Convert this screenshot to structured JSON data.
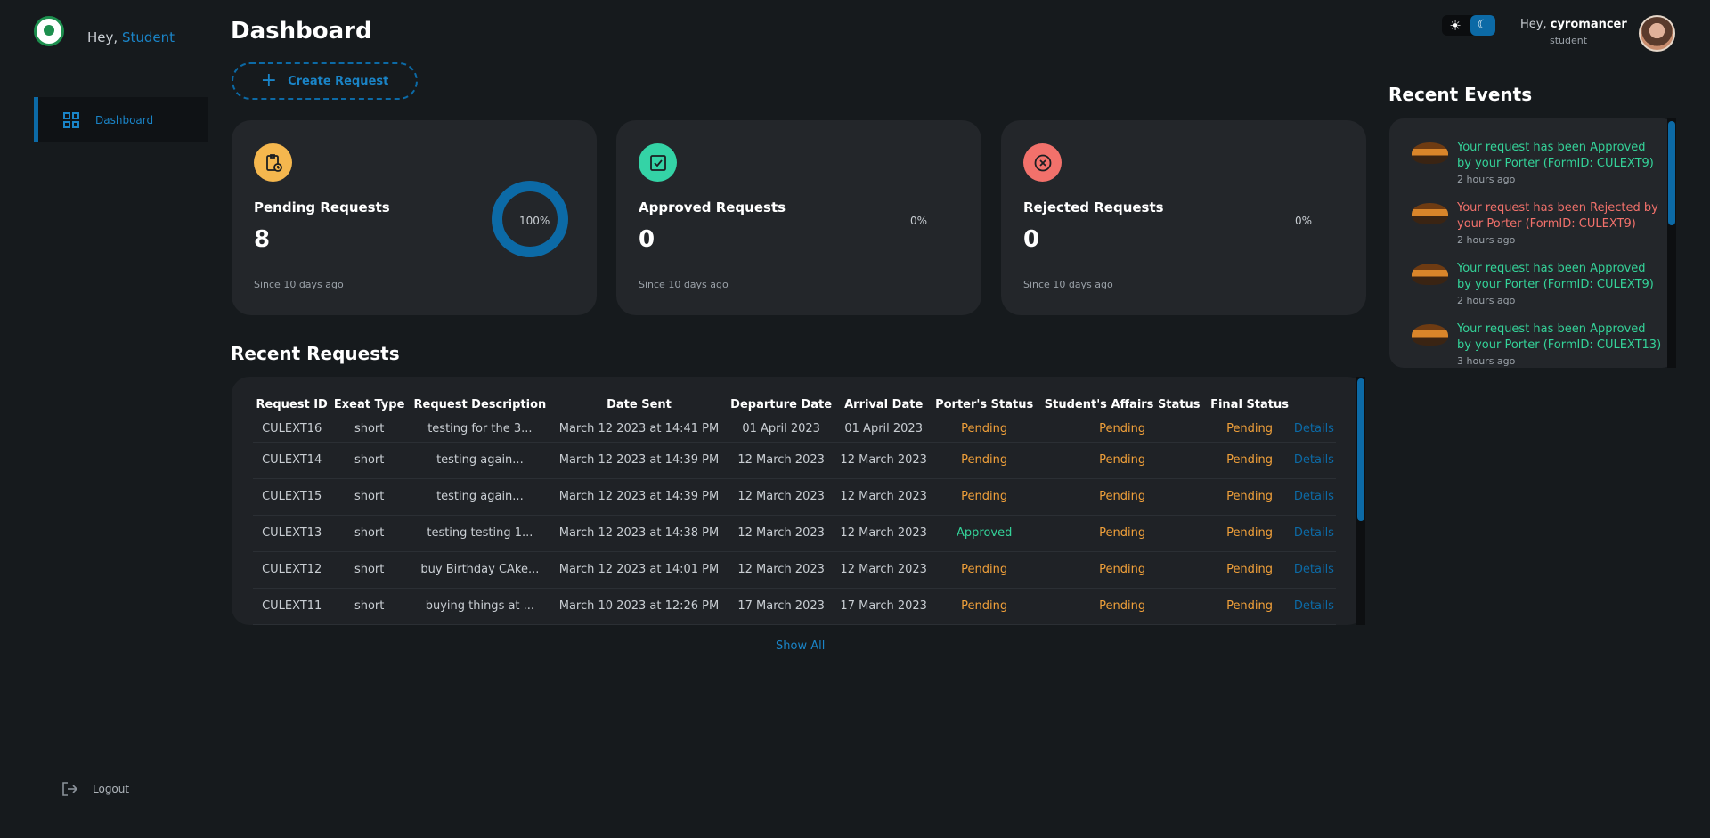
{
  "sidebar": {
    "greeting_prefix": "Hey,",
    "greeting_name": "Student",
    "nav": [
      {
        "label": "Dashboard",
        "icon": "dashboard-icon"
      }
    ],
    "logout_label": "Logout"
  },
  "header": {
    "title": "Dashboard",
    "create_request_label": "Create Request",
    "user_greeting_prefix": "Hey,",
    "user_name": "cyromancer",
    "user_role": "student",
    "theme": "dark"
  },
  "cards": [
    {
      "title": "Pending Requests",
      "count": "8",
      "percent_label": "100%",
      "percent_value": 1.0,
      "since": "Since 10 days ago",
      "icon": "clipboard-clock-icon",
      "icon_bg": "#f5b74e"
    },
    {
      "title": "Approved Requests",
      "count": "0",
      "percent_label": "0%",
      "percent_value": 0,
      "since": "Since 10 days ago",
      "icon": "check-square-icon",
      "icon_bg": "#34d3a6"
    },
    {
      "title": "Rejected Requests",
      "count": "0",
      "percent_label": "0%",
      "percent_value": 0,
      "since": "Since 10 days ago",
      "icon": "x-circle-icon",
      "icon_bg": "#f2716b"
    }
  ],
  "recent_requests": {
    "title": "Recent Requests",
    "columns": [
      "Request ID",
      "Exeat Type",
      "Request Description",
      "Date Sent",
      "Departure Date",
      "Arrival Date",
      "Porter's Status",
      "Student's Affairs Status",
      "Final Status",
      ""
    ],
    "rows": [
      {
        "id": "CULEXT16",
        "type": "short",
        "desc": "testing for the 3...",
        "sent": "March 12 2023 at 14:41 PM",
        "departure": "01 April 2023",
        "arrival": "01 April 2023",
        "porter": "Pending",
        "affairs": "Pending",
        "final": "Pending",
        "action": "Details"
      },
      {
        "id": "CULEXT14",
        "type": "short",
        "desc": "testing again...",
        "sent": "March 12 2023 at 14:39 PM",
        "departure": "12 March 2023",
        "arrival": "12 March 2023",
        "porter": "Pending",
        "affairs": "Pending",
        "final": "Pending",
        "action": "Details"
      },
      {
        "id": "CULEXT15",
        "type": "short",
        "desc": "testing again...",
        "sent": "March 12 2023 at 14:39 PM",
        "departure": "12 March 2023",
        "arrival": "12 March 2023",
        "porter": "Pending",
        "affairs": "Pending",
        "final": "Pending",
        "action": "Details"
      },
      {
        "id": "CULEXT13",
        "type": "short",
        "desc": "testing testing 1...",
        "sent": "March 12 2023 at 14:38 PM",
        "departure": "12 March 2023",
        "arrival": "12 March 2023",
        "porter": "Approved",
        "affairs": "Pending",
        "final": "Pending",
        "action": "Details"
      },
      {
        "id": "CULEXT12",
        "type": "short",
        "desc": "buy Birthday CAke...",
        "sent": "March 12 2023 at 14:01 PM",
        "departure": "12 March 2023",
        "arrival": "12 March 2023",
        "porter": "Pending",
        "affairs": "Pending",
        "final": "Pending",
        "action": "Details"
      },
      {
        "id": "CULEXT11",
        "type": "short",
        "desc": "buying things at ...",
        "sent": "March 10 2023 at 12:26 PM",
        "departure": "17 March 2023",
        "arrival": "17 March 2023",
        "porter": "Pending",
        "affairs": "Pending",
        "final": "Pending",
        "action": "Details"
      }
    ],
    "show_all_label": "Show All"
  },
  "recent_events": {
    "title": "Recent Events",
    "items": [
      {
        "message": "Your request has been Approved by your Porter (FormID: CULEXT9)",
        "time": "2 hours ago",
        "status": "approved"
      },
      {
        "message": "Your request has been Rejected by your Porter (FormID: CULEXT9)",
        "time": "2 hours ago",
        "status": "rejected"
      },
      {
        "message": "Your request has been Approved by your Porter (FormID: CULEXT9)",
        "time": "2 hours ago",
        "status": "approved"
      },
      {
        "message": "Your request has been Approved by your Porter (FormID: CULEXT13)",
        "time": "3 hours ago",
        "status": "approved"
      }
    ]
  },
  "colors": {
    "accent": "#0c6aa6",
    "pending": "#f0a03a",
    "approved": "#34d399",
    "rejected": "#f2716b",
    "background": "#161a1d",
    "card": "#23262a"
  }
}
